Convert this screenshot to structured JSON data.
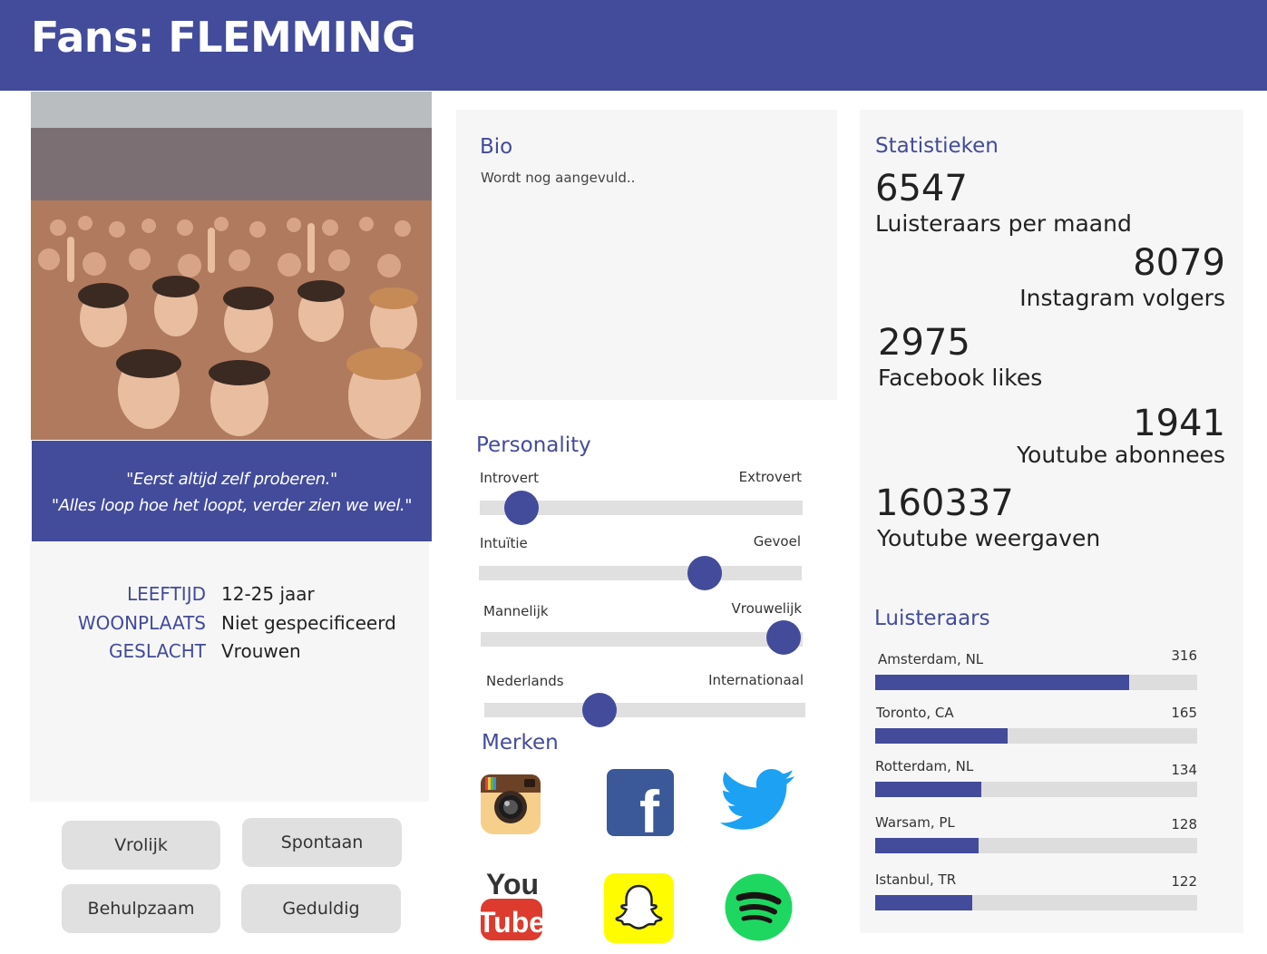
{
  "header": {
    "title": "Fans: FLEMMING"
  },
  "profile": {
    "quote_line1": "\"Eerst altijd zelf proberen.\"",
    "quote_line2": "\"Alles loop hoe het loopt, verder zien we wel.\"",
    "info": [
      {
        "label": "LEEFTIJD",
        "value": "12-25 jaar"
      },
      {
        "label": "WOONPLAATS",
        "value": "Niet gespecificeerd"
      },
      {
        "label": "GESLACHT",
        "value": "Vrouwen"
      }
    ],
    "traits": [
      "Vrolijk",
      "Spontaan",
      "Behulpzaam",
      "Geduldig"
    ]
  },
  "bio": {
    "title": "Bio",
    "text": "Wordt nog aangevuld.."
  },
  "personality": {
    "title": "Personality",
    "sliders": [
      {
        "left": "Introvert",
        "right": "Extrovert",
        "position": 0.13
      },
      {
        "left": "Intuïtie",
        "right": "Gevoel",
        "position": 0.7
      },
      {
        "left": "Mannelijk",
        "right": "Vrouwelijk",
        "position": 0.94
      },
      {
        "left": "Nederlands",
        "right": "Internationaal",
        "position": 0.36
      }
    ]
  },
  "brands": {
    "title": "Merken",
    "items": [
      "instagram-icon",
      "facebook-icon",
      "twitter-icon",
      "youtube-icon",
      "snapchat-icon",
      "spotify-icon"
    ],
    "youtube_you": "You",
    "youtube_tube": "Tube",
    "facebook_letter": "f"
  },
  "stats": {
    "title": "Statistieken",
    "items": [
      {
        "value": "6547",
        "label": "Luisteraars per maand"
      },
      {
        "value": "8079",
        "label": "Instagram volgers"
      },
      {
        "value": "2975",
        "label": "Facebook likes"
      },
      {
        "value": "1941",
        "label": "Youtube abonnees"
      },
      {
        "value": "160337",
        "label": "Youtube weergaven"
      }
    ]
  },
  "listeners": {
    "title": "Luisteraars",
    "items": [
      {
        "city": "Amsterdam, NL",
        "count": "316",
        "fraction": 0.79
      },
      {
        "city": "Toronto, CA",
        "count": "165",
        "fraction": 0.41
      },
      {
        "city": "Rotterdam, NL",
        "count": "134",
        "fraction": 0.33
      },
      {
        "city": "Warsam, PL",
        "count": "128",
        "fraction": 0.32
      },
      {
        "city": "Istanbul, TR",
        "count": "122",
        "fraction": 0.3
      }
    ]
  },
  "colors": {
    "accent": "#434b9b",
    "panel": "#f6f6f6",
    "track": "#e0e0e0"
  }
}
